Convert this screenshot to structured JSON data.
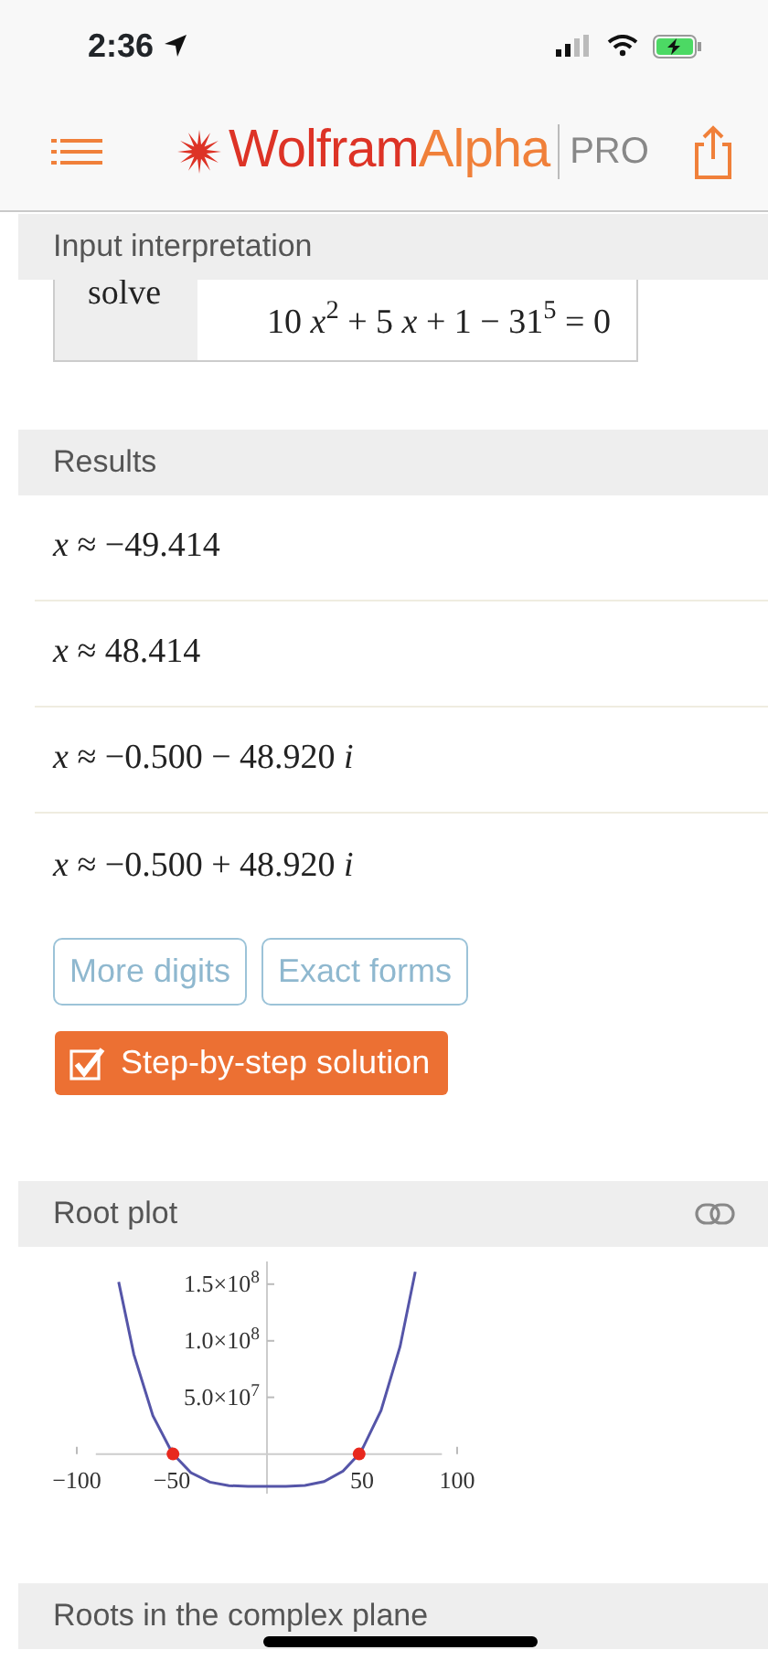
{
  "status_bar": {
    "time": "2:36"
  },
  "header": {
    "brand": [
      "Wolfram",
      "Alpha"
    ],
    "tier": "PRO"
  },
  "pods": [
    {
      "kind": "input",
      "title": "Input interpretation",
      "label": "solve",
      "expression": "10 *x*$^{2}$ + 5 *x* + 1 − 31$^{5}$ = 0"
    },
    {
      "kind": "results",
      "title": "Results",
      "rows": [
        "*x* ≈ −49.414",
        "*x* ≈ 48.414",
        "*x* ≈ −0.500 − 48.920 *i*",
        "*x* ≈ −0.500 + 48.920 *i*"
      ],
      "buttons": [
        "More digits",
        "Exact forms"
      ],
      "action": "Step-by-step solution"
    },
    {
      "kind": "plot",
      "title": "Root plot",
      "chart_data": {
        "type": "line",
        "x": [
          -78,
          -70,
          -60,
          -50,
          -49.414,
          -40,
          -30,
          -20,
          -10,
          0,
          10,
          20,
          30,
          40,
          48.414,
          50,
          60,
          70,
          78
        ],
        "series": [
          {
            "color": "#5555a8",
            "values": [
              152000000,
              88000000,
              34000000,
              1400000,
              0,
              -16500000,
              -24800000,
              -27900000,
              -28600000,
              -28600000,
              -28600000,
              -27700000,
              -24300000,
              -15200000,
              0,
              3900000,
              38400000,
              94900000,
              161000000
            ]
          }
        ],
        "xlim": [
          -100,
          100
        ],
        "ylim": [
          -35000000,
          170000000
        ],
        "xticks": [
          {
            "value": -100,
            "label": "−100"
          },
          {
            "value": -50,
            "label": "−50"
          },
          {
            "value": 50,
            "label": "50"
          },
          {
            "value": 100,
            "label": "100"
          }
        ],
        "yticks": [
          {
            "value": 50000000,
            "label": "5.0×10$^{7}$"
          },
          {
            "value": 100000000,
            "label": "1.0×10$^{8}$"
          },
          {
            "value": 150000000,
            "label": "1.5×10$^{8}$"
          }
        ]
      }
    },
    {
      "kind": "header_only",
      "title": "Roots in the complex plane"
    }
  ]
}
